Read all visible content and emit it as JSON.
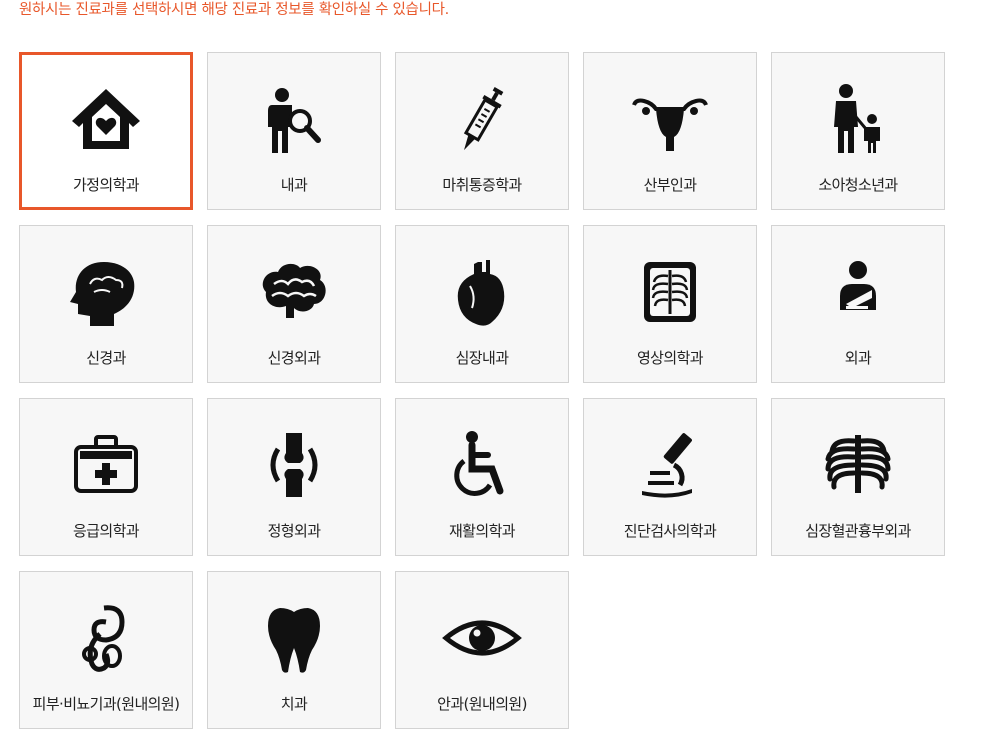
{
  "intro_text": "원하시는 진료과를 선택하시면 해당 진료과 정보를 확인하실 수 있습니다.",
  "accent_color": "#e8572a",
  "departments": [
    {
      "label": "가정의학과",
      "icon": "home-heart-icon",
      "selected": true
    },
    {
      "label": "내과",
      "icon": "doctor-magnifier-icon",
      "selected": false
    },
    {
      "label": "마취통증학과",
      "icon": "syringe-icon",
      "selected": false
    },
    {
      "label": "산부인과",
      "icon": "uterus-icon",
      "selected": false
    },
    {
      "label": "소아청소년과",
      "icon": "parent-child-icon",
      "selected": false
    },
    {
      "label": "신경과",
      "icon": "head-brain-icon",
      "selected": false
    },
    {
      "label": "신경외과",
      "icon": "brain-icon",
      "selected": false
    },
    {
      "label": "심장내과",
      "icon": "heart-organ-icon",
      "selected": false
    },
    {
      "label": "영상의학과",
      "icon": "xray-icon",
      "selected": false
    },
    {
      "label": "외과",
      "icon": "patient-sling-icon",
      "selected": false
    },
    {
      "label": "응급의학과",
      "icon": "first-aid-kit-icon",
      "selected": false
    },
    {
      "label": "정형외과",
      "icon": "knee-joint-icon",
      "selected": false
    },
    {
      "label": "재활의학과",
      "icon": "wheelchair-icon",
      "selected": false
    },
    {
      "label": "진단검사의학과",
      "icon": "microscope-icon",
      "selected": false
    },
    {
      "label": "심장혈관흉부외과",
      "icon": "ribcage-icon",
      "selected": false
    },
    {
      "label": "피부·비뇨기과(원내의원)",
      "icon": "urology-icon",
      "selected": false
    },
    {
      "label": "치과",
      "icon": "tooth-icon",
      "selected": false
    },
    {
      "label": "안과(원내의원)",
      "icon": "eye-icon",
      "selected": false
    }
  ]
}
